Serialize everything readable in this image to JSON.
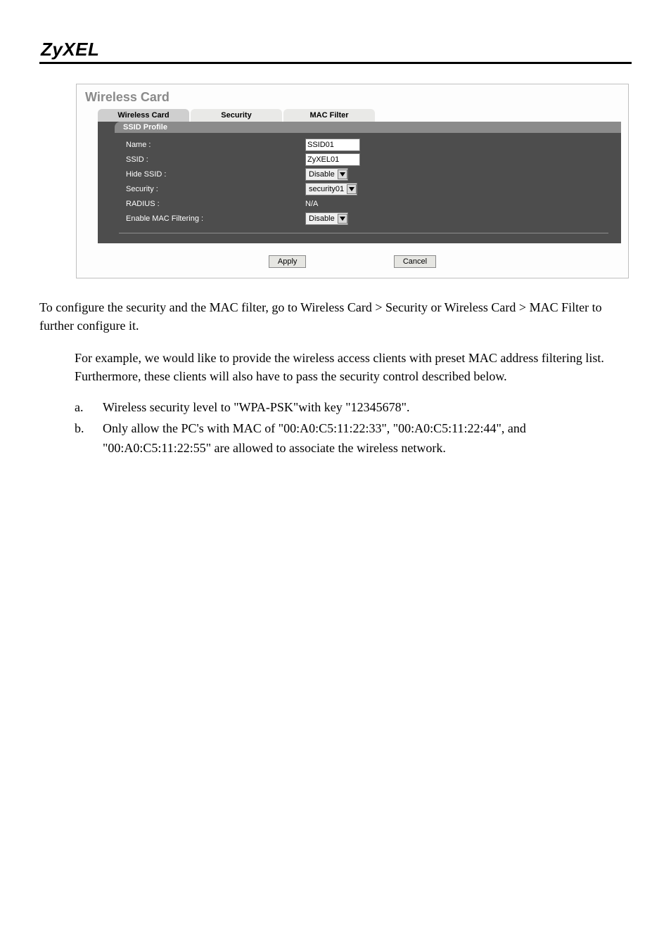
{
  "brand": "ZyXEL",
  "panel": {
    "title": "Wireless Card",
    "tabs": [
      "Wireless Card",
      "Security",
      "MAC Filter"
    ],
    "active_tab_index": 0,
    "section_header": "SSID Profile",
    "rows": {
      "name_label": "Name :",
      "name_value": "SSID01",
      "ssid_label": "SSID :",
      "ssid_value": "ZyXEL01",
      "hide_ssid_label": "Hide SSID :",
      "hide_ssid_value": "Disable",
      "security_label": "Security :",
      "security_value": "security01",
      "radius_label": "RADIUS :",
      "radius_value": "N/A",
      "mac_filter_label": "Enable MAC Filtering :",
      "mac_filter_value": "Disable"
    },
    "apply_label": "Apply",
    "cancel_label": "Cancel"
  },
  "body": {
    "para1_a": "To configure the security and the MAC filter, go to ",
    "para1_b": "Wireless Card > Security",
    "para1_c": " or ",
    "para1_d": "Wireless Card > MAC Filter",
    "para1_e": " to further configure it.",
    "para2": "For example, we would like to provide the wireless access clients with preset MAC address filtering list. Furthermore, these clients will also have to pass the security control described below.",
    "list": {
      "a_marker": "a.",
      "a_text": "Wireless security level to \"WPA-PSK\"with key \"12345678\".",
      "b_marker": "b.",
      "b_text": "Only allow the PC's with MAC of \"00:A0:C5:11:22:33\", \"00:A0:C5:11:22:44\", and \"00:A0:C5:11:22:55\" are allowed to associate the wireless network."
    }
  }
}
